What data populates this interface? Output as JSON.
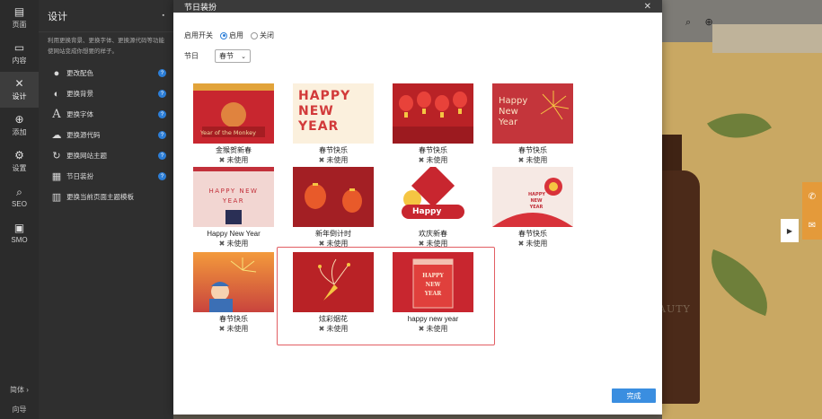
{
  "rail": [
    {
      "label": "页面",
      "icon": "page-icon"
    },
    {
      "label": "内容",
      "icon": "content-icon"
    },
    {
      "label": "设计",
      "icon": "design-icon"
    },
    {
      "label": "添加",
      "icon": "add-icon"
    },
    {
      "label": "设置",
      "icon": "settings-icon"
    },
    {
      "label": "SEO",
      "icon": "search-icon"
    },
    {
      "label": "SMO",
      "icon": "briefcase-icon"
    }
  ],
  "rail_bottom": [
    "简体 ›",
    "向导"
  ],
  "panel": {
    "title": "设计",
    "pin": "▪",
    "desc": "利用更换背景、更换字体、更换源代码等功能使网站变成你想要的样子。",
    "items": [
      {
        "label": "更改配色",
        "icon": "drop-icon"
      },
      {
        "label": "更换背景",
        "icon": "contrast-icon"
      },
      {
        "label": "更换字体",
        "icon": "font-icon"
      },
      {
        "label": "更换源代码",
        "icon": "cloud-icon"
      },
      {
        "label": "更换网站主题",
        "icon": "refresh-icon"
      },
      {
        "label": "节日装扮",
        "icon": "gift-icon"
      },
      {
        "label": "更换当前页面主题模板",
        "icon": "template-icon"
      }
    ]
  },
  "modal": {
    "title": "节日装扮",
    "close": "✕",
    "switch_label": "启用开关",
    "radio_on": "启用",
    "radio_off": "关闭",
    "festival_label": "节日",
    "festival_value": "春节",
    "done_label": "完成"
  },
  "cards": [
    {
      "name": "金猴贺新春",
      "status": "未使用",
      "art": "Year of the Monkey"
    },
    {
      "name": "春节快乐",
      "status": "未使用",
      "art": "HAPPY NEW YEAR"
    },
    {
      "name": "春节快乐",
      "status": "未使用",
      "art": ""
    },
    {
      "name": "春节快乐",
      "status": "未使用",
      "art": "Happy New Year"
    },
    {
      "name": "Happy New Year",
      "status": "未使用",
      "art": "HAPPY NEW YEAR"
    },
    {
      "name": "新年倒计时",
      "status": "未使用",
      "art": ""
    },
    {
      "name": "欢庆新春",
      "status": "未使用",
      "art": "Happy"
    },
    {
      "name": "春节快乐",
      "status": "未使用",
      "art": "HAPPY NEW YEAR"
    },
    {
      "name": "春节快乐",
      "status": "未使用",
      "art": ""
    },
    {
      "name": "炫彩烟花",
      "status": "未使用",
      "art": ""
    },
    {
      "name": "happy new year",
      "status": "未使用",
      "art": "HAPPY NEW YEAR"
    }
  ],
  "site": {
    "beauty": "AUTY"
  },
  "colors": {
    "accent": "#2d7fd8",
    "highlight": "#e25e63",
    "rail": "#2b2b2b",
    "panel": "#2f2f2f"
  }
}
